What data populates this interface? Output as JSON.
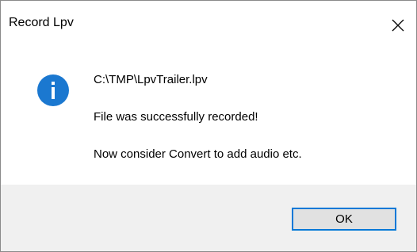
{
  "window": {
    "title": "Record Lpv",
    "close_icon": "close-icon"
  },
  "message": {
    "icon": "info-icon",
    "accent_color": "#0078d7",
    "lines": [
      "C:\\TMP\\LpvTrailer.lpv",
      "File was successfully recorded!",
      "Now consider Convert to add audio etc."
    ]
  },
  "buttons": {
    "ok_label": "OK"
  }
}
